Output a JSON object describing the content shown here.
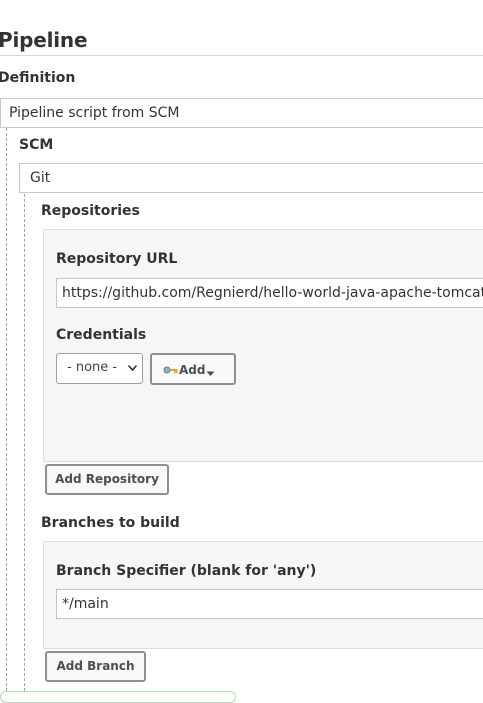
{
  "section": {
    "title": "Pipeline",
    "definition_label": "Definition",
    "definition_value": "Pipeline script from SCM",
    "scm_label": "SCM",
    "scm_value": "Git"
  },
  "repositories": {
    "label": "Repositories",
    "url_label": "Repository URL",
    "url_value": "https://github.com/Regnierd/hello-world-java-apache-tomcat",
    "credentials_label": "Credentials",
    "credentials_selected": "- none -",
    "add_label": "Add",
    "add_repository_label": "Add Repository"
  },
  "branches": {
    "label": "Branches to build",
    "specifier_label": "Branch Specifier (blank for 'any')",
    "specifier_value": "*/main",
    "add_branch_label": "Add Branch"
  },
  "icons": {
    "add_key": "key-icon",
    "dropdown": "chevron-down-icon"
  },
  "colors": {
    "panel_bg": "#f6f6f6",
    "button_border": "#8a8f94",
    "rule": "#d9d9d9"
  }
}
